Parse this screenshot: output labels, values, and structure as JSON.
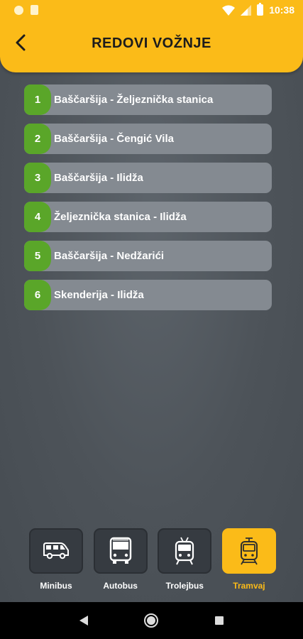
{
  "status_bar": {
    "time": "10:38"
  },
  "header": {
    "title": "REDOVI VOŽNJE",
    "back_icon": "arrow-back-icon"
  },
  "routes": [
    {
      "number": "1",
      "name": "Baščaršija - Željeznička stanica"
    },
    {
      "number": "2",
      "name": "Baščaršija - Čengić Vila"
    },
    {
      "number": "3",
      "name": "Baščaršija - Ilidža"
    },
    {
      "number": "4",
      "name": "Željeznička stanica - Ilidža"
    },
    {
      "number": "5",
      "name": "Baščaršija - Nedžarići"
    },
    {
      "number": "6",
      "name": "Skenderija - Ilidža"
    }
  ],
  "tabs": [
    {
      "label": "Minibus",
      "icon": "minibus-icon",
      "active": false
    },
    {
      "label": "Autobus",
      "icon": "bus-icon",
      "active": false
    },
    {
      "label": "Trolejbus",
      "icon": "trolleybus-icon",
      "active": false
    },
    {
      "label": "Tramvaj",
      "icon": "tram-icon",
      "active": true
    }
  ],
  "colors": {
    "accent": "#fbbb18",
    "route_number_bg": "#5aa629",
    "route_item_bg": "#848a91",
    "tab_bg": "#363b41"
  }
}
